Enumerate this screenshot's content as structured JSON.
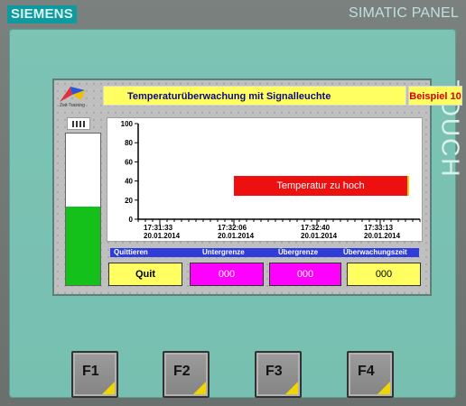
{
  "brand": "SIEMENS",
  "model": "SIMATIC PANEL",
  "touch_label": "TOUCH",
  "logo_text": "Zeit-Training",
  "title": "Temperaturüberwachung mit Signalleuchte",
  "example": "Beispiel 10",
  "thermometer": {
    "level_fraction": 0.52
  },
  "chart": {
    "y_ticks": [
      "100",
      "80",
      "60",
      "40",
      "20",
      "0"
    ],
    "x_ticks": [
      {
        "time": "17:31:33",
        "date": "20.01.2014"
      },
      {
        "time": "17:32:06",
        "date": "20.01.2014"
      },
      {
        "time": "17:32:40",
        "date": "20.01.2014"
      },
      {
        "time": "17:33:13",
        "date": "20.01.2014"
      }
    ],
    "alarm_text": "Temperatur zu hoch"
  },
  "legend": [
    "Quittieren",
    "Untergrenze",
    "Übergrenze",
    "Überwachungszeit"
  ],
  "controls": {
    "quit": "Quit",
    "lower": "000",
    "upper": "000",
    "time": "000"
  },
  "fkeys": [
    "F1",
    "F2",
    "F3",
    "F4"
  ],
  "colors": {
    "title_bg": "#ffff61",
    "alarm": "#ee0f0f",
    "legend_bg": "#2f3cd8",
    "magenta": "#ff00ff",
    "thermo_fill": "#14c01a"
  }
}
